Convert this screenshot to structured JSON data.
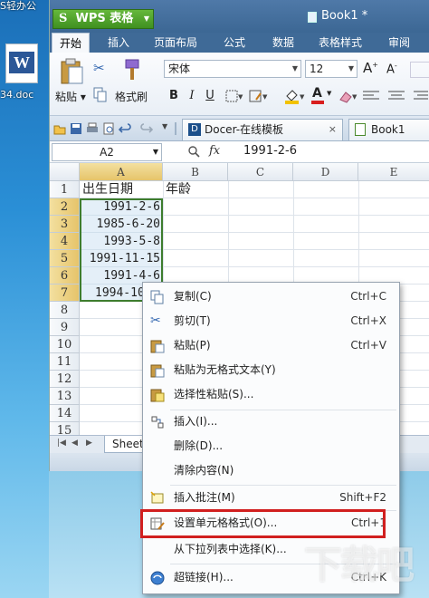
{
  "desktop": {
    "top_text": "S轻办公",
    "icon_label": "34.doc"
  },
  "titlebar": {
    "app_button_logo": "S",
    "app_button_label": "WPS 表格",
    "document_title": "Book1 *"
  },
  "ribbon_tabs": [
    "开始",
    "插入",
    "页面布局",
    "公式",
    "数据",
    "表格样式",
    "审阅"
  ],
  "ribbon": {
    "paste_label": "粘贴",
    "format_painter_label": "格式刷",
    "font_name": "宋体",
    "font_size": "12",
    "font_grow": "A",
    "font_shrink": "A",
    "bold": "B",
    "italic": "I",
    "underline": "U",
    "font_color_letter": "A",
    "font_color": "#d81e1e",
    "fill_color": "#f2c200"
  },
  "doc_tabs": [
    "Docer-在线模板",
    "Book1"
  ],
  "formula_bar": {
    "cell_ref": "A2",
    "fx": "fx",
    "formula": "1991-2-6"
  },
  "grid": {
    "columns": [
      "A",
      "B",
      "C",
      "D",
      "E"
    ],
    "rows": [
      "1",
      "2",
      "3",
      "4",
      "5",
      "6",
      "7",
      "8",
      "9",
      "10",
      "11",
      "12",
      "13",
      "14",
      "15"
    ],
    "header_a1": "出生日期",
    "header_b1": "年龄",
    "dates": [
      "1991-2-6",
      "1985-6-20",
      "1993-5-8",
      "1991-11-15",
      "1991-4-6",
      "1994-10"
    ]
  },
  "sheet_tab": "Sheet",
  "context_menu": [
    {
      "label": "复制(C)",
      "shortcut": "Ctrl+C",
      "icon": "copy-icon"
    },
    {
      "label": "剪切(T)",
      "shortcut": "Ctrl+X",
      "icon": "scissors-icon"
    },
    {
      "label": "粘贴(P)",
      "shortcut": "Ctrl+V",
      "icon": "paste-icon"
    },
    {
      "label": "粘贴为无格式文本(Y)",
      "shortcut": "",
      "icon": "paste-text-icon"
    },
    {
      "label": "选择性粘贴(S)...",
      "shortcut": "",
      "icon": "paste-special-icon"
    },
    {
      "label": "插入(I)...",
      "shortcut": "",
      "icon": "insert-icon"
    },
    {
      "label": "删除(D)...",
      "shortcut": "",
      "icon": ""
    },
    {
      "label": "清除内容(N)",
      "shortcut": "",
      "icon": ""
    },
    {
      "label": "插入批注(M)",
      "shortcut": "Shift+F2",
      "icon": "comment-icon"
    },
    {
      "label": "设置单元格格式(O)...",
      "shortcut": "Ctrl+1",
      "icon": "format-cells-icon"
    },
    {
      "label": "从下拉列表中选择(K)...",
      "shortcut": "",
      "icon": ""
    },
    {
      "label": "超链接(H)...",
      "shortcut": "Ctrl+K",
      "icon": "hyperlink-icon"
    }
  ],
  "watermark": "下载吧",
  "colors": {
    "title_bar": "#4f79a8",
    "wps_green": "#4fa52a",
    "selection_border": "#3e7d2e",
    "highlight_red": "#d11f1f"
  }
}
